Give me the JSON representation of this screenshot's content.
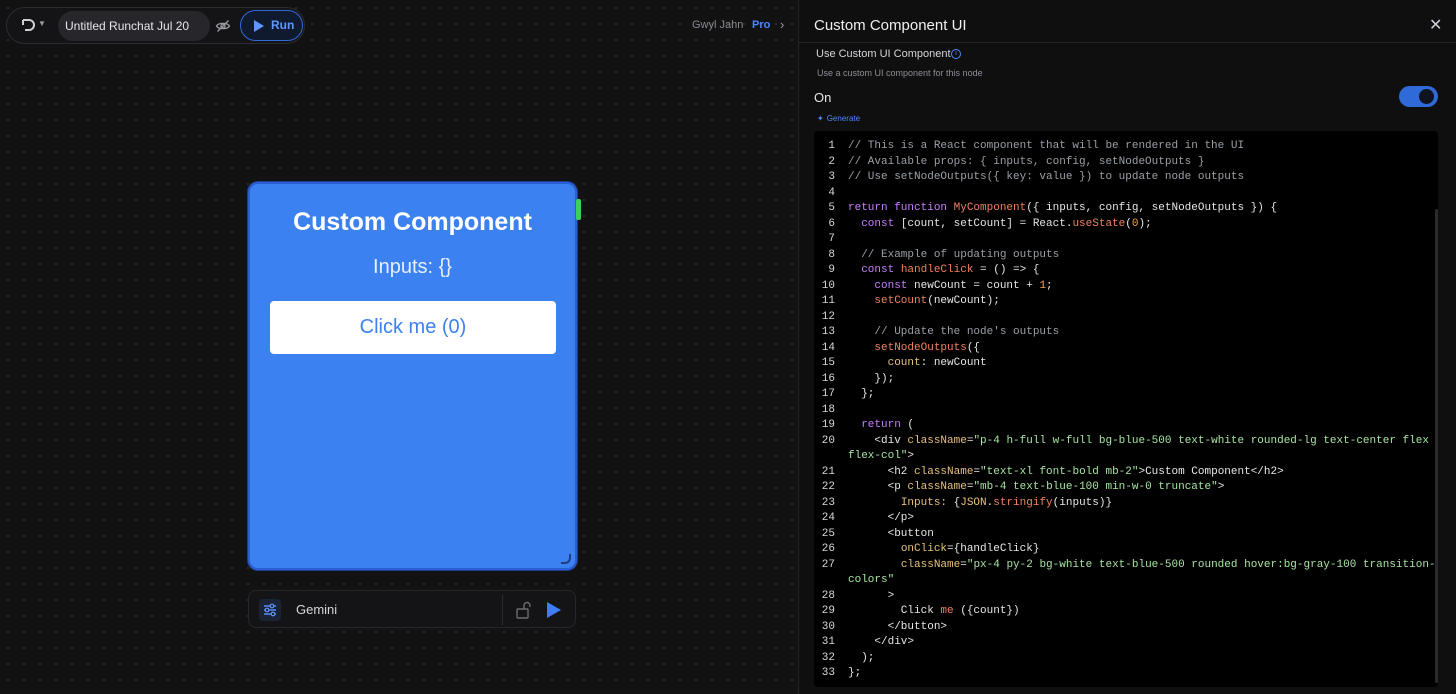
{
  "topbar": {
    "title_value": "Untitled Runchat Jul 20",
    "run_label": "Run",
    "user_name": "Gwyl Jahn",
    "plan_badge": "Pro"
  },
  "node": {
    "title": "Custom Component",
    "inputs_text": "Inputs: {}",
    "button_label": "Click me (0)",
    "model_name": "Gemini"
  },
  "panel": {
    "title": "Custom Component UI",
    "field_label": "Use Custom UI Component",
    "field_description": "Use a custom UI component for this node",
    "toggle_state": "On",
    "generate_label": "Generate"
  },
  "colors": {
    "accent": "#3b82f0",
    "comment": "#9aa0a6",
    "keyword": "#c77dff",
    "function": "#f08060",
    "string": "#a6e3a1",
    "number": "#f5a742",
    "property": "#e6c07b"
  },
  "code": {
    "lines": [
      {
        "n": "1",
        "parts": [
          [
            "// This is a React component that will be rendered in the UI",
            "comment"
          ]
        ]
      },
      {
        "n": "2",
        "parts": [
          [
            "// Available props: { inputs, config, setNodeOutputs }",
            "comment"
          ]
        ]
      },
      {
        "n": "3",
        "parts": [
          [
            "// Use setNodeOutputs({ key: value }) to update node outputs",
            "comment"
          ]
        ]
      },
      {
        "n": "4",
        "parts": []
      },
      {
        "n": "5",
        "parts": [
          [
            "return function ",
            "keyword"
          ],
          [
            "MyComponent",
            "function"
          ],
          [
            "({ inputs, config, setNodeOutputs }) {",
            "plain"
          ]
        ]
      },
      {
        "n": "6",
        "parts": [
          [
            "  const ",
            "keyword"
          ],
          [
            "[count, setCount] = React.",
            "plain"
          ],
          [
            "useState",
            "function"
          ],
          [
            "(",
            "plain"
          ],
          [
            "0",
            "number"
          ],
          [
            ");",
            "plain"
          ]
        ]
      },
      {
        "n": "7",
        "parts": []
      },
      {
        "n": "8",
        "parts": [
          [
            "  // Example of updating outputs",
            "comment"
          ]
        ]
      },
      {
        "n": "9",
        "parts": [
          [
            "  const ",
            "keyword"
          ],
          [
            "handleClick",
            "function"
          ],
          [
            " = () => {",
            "plain"
          ]
        ]
      },
      {
        "n": "10",
        "parts": [
          [
            "    const ",
            "keyword"
          ],
          [
            "newCount = count + ",
            "plain"
          ],
          [
            "1",
            "number"
          ],
          [
            ";",
            "plain"
          ]
        ]
      },
      {
        "n": "11",
        "parts": [
          [
            "    ",
            "plain"
          ],
          [
            "setCount",
            "function"
          ],
          [
            "(newCount);",
            "plain"
          ]
        ]
      },
      {
        "n": "12",
        "parts": []
      },
      {
        "n": "13",
        "parts": [
          [
            "    // Update the node's outputs",
            "comment"
          ]
        ]
      },
      {
        "n": "14",
        "parts": [
          [
            "    ",
            "plain"
          ],
          [
            "setNodeOutputs",
            "function"
          ],
          [
            "({",
            "plain"
          ]
        ]
      },
      {
        "n": "15",
        "parts": [
          [
            "      ",
            "plain"
          ],
          [
            "count",
            "property"
          ],
          [
            ": newCount",
            "plain"
          ]
        ]
      },
      {
        "n": "16",
        "parts": [
          [
            "    });",
            "plain"
          ]
        ]
      },
      {
        "n": "17",
        "parts": [
          [
            "  };",
            "plain"
          ]
        ]
      },
      {
        "n": "18",
        "parts": []
      },
      {
        "n": "19",
        "parts": [
          [
            "  return ",
            "keyword"
          ],
          [
            "(",
            "plain"
          ]
        ]
      },
      {
        "n": "20",
        "parts": [
          [
            "    <div ",
            "plain"
          ],
          [
            "className",
            "property"
          ],
          [
            "=",
            "plain"
          ],
          [
            "\"p-4 h-full w-full bg-blue-500 text-white rounded-lg text-center flex",
            "string"
          ]
        ]
      },
      {
        "n": "",
        "parts": [
          [
            "flex-col\"",
            "string"
          ],
          [
            ">",
            "plain"
          ]
        ],
        "wrap": true
      },
      {
        "n": "21",
        "parts": [
          [
            "      <h2 ",
            "plain"
          ],
          [
            "className",
            "property"
          ],
          [
            "=",
            "plain"
          ],
          [
            "\"text-xl font-bold mb-2\"",
            "string"
          ],
          [
            ">Custom Component</h2>",
            "plain"
          ]
        ]
      },
      {
        "n": "22",
        "parts": [
          [
            "      <p ",
            "plain"
          ],
          [
            "className",
            "property"
          ],
          [
            "=",
            "plain"
          ],
          [
            "\"mb-4 text-blue-100 min-w-0 truncate\"",
            "string"
          ],
          [
            ">",
            "plain"
          ]
        ]
      },
      {
        "n": "23",
        "parts": [
          [
            "        ",
            "plain"
          ],
          [
            "Inputs: ",
            "property"
          ],
          [
            "{",
            "plain"
          ],
          [
            "JSON",
            "property"
          ],
          [
            ".",
            "plain"
          ],
          [
            "stringify",
            "function"
          ],
          [
            "(inputs)}",
            "plain"
          ]
        ]
      },
      {
        "n": "24",
        "parts": [
          [
            "      </p>",
            "plain"
          ]
        ]
      },
      {
        "n": "25",
        "parts": [
          [
            "      <button",
            "plain"
          ]
        ]
      },
      {
        "n": "26",
        "parts": [
          [
            "        ",
            "plain"
          ],
          [
            "onClick",
            "property"
          ],
          [
            "={handleClick}",
            "plain"
          ]
        ]
      },
      {
        "n": "27",
        "parts": [
          [
            "        ",
            "plain"
          ],
          [
            "className",
            "property"
          ],
          [
            "=",
            "plain"
          ],
          [
            "\"px-4 py-2 bg-white text-blue-500 rounded hover:bg-gray-100 transition-",
            "string"
          ]
        ]
      },
      {
        "n": "",
        "parts": [
          [
            "colors\"",
            "string"
          ]
        ],
        "wrap": true
      },
      {
        "n": "28",
        "parts": [
          [
            "      >",
            "plain"
          ]
        ]
      },
      {
        "n": "29",
        "parts": [
          [
            "        Click ",
            "plain"
          ],
          [
            "me",
            "function"
          ],
          [
            " ({count})",
            "plain"
          ]
        ]
      },
      {
        "n": "30",
        "parts": [
          [
            "      </button>",
            "plain"
          ]
        ]
      },
      {
        "n": "31",
        "parts": [
          [
            "    </div>",
            "plain"
          ]
        ]
      },
      {
        "n": "32",
        "parts": [
          [
            "  );",
            "plain"
          ]
        ]
      },
      {
        "n": "33",
        "parts": [
          [
            "};",
            "plain"
          ]
        ]
      }
    ]
  }
}
